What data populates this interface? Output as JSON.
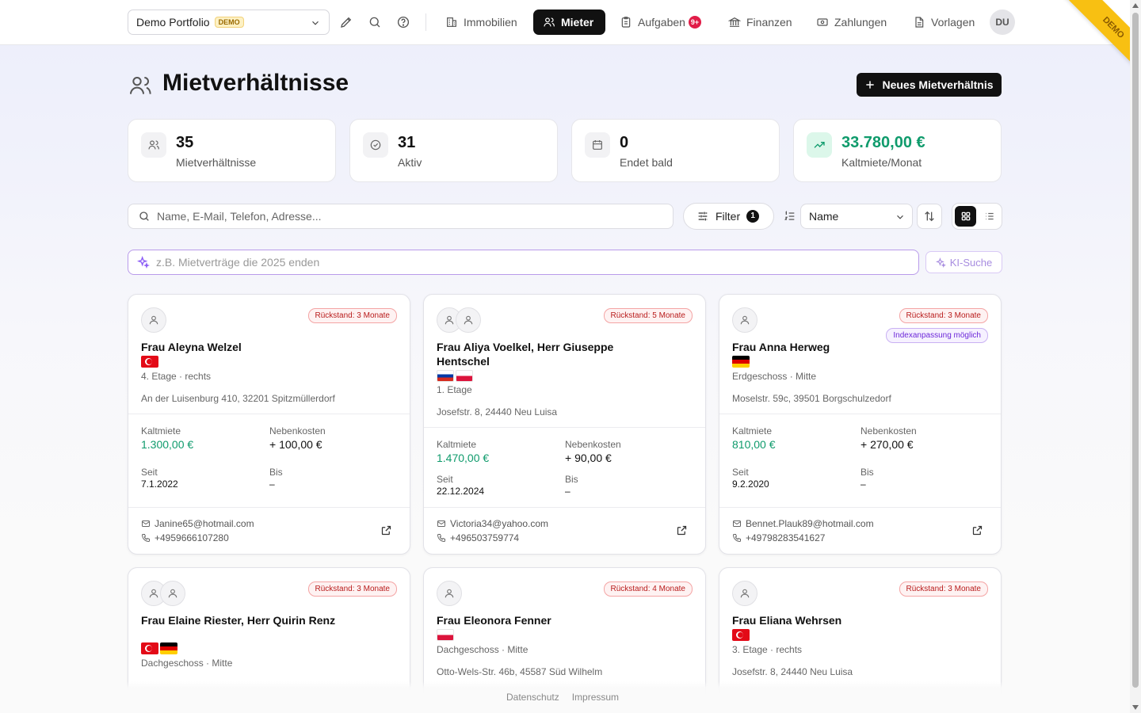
{
  "header": {
    "portfolio_name": "Demo Portfolio",
    "portfolio_badge": "DEMO",
    "nav": [
      {
        "label": "Immobilien",
        "icon": "building-icon"
      },
      {
        "label": "Mieter",
        "icon": "users-icon",
        "active": true
      },
      {
        "label": "Aufgaben",
        "icon": "clipboard-icon",
        "badge": "9+"
      },
      {
        "label": "Finanzen",
        "icon": "bank-icon"
      },
      {
        "label": "Zahlungen",
        "icon": "banknote-icon"
      },
      {
        "label": "Vorlagen",
        "icon": "file-icon"
      }
    ],
    "user_initials": "DU",
    "ribbon": "DEMO"
  },
  "page": {
    "title": "Mietverhältnisse",
    "new_button": "Neues Mietverhältnis"
  },
  "stats": [
    {
      "value": "35",
      "label": "Mietverhältnisse",
      "icon": "users-icon"
    },
    {
      "value": "31",
      "label": "Aktiv",
      "icon": "check-circle-icon"
    },
    {
      "value": "0",
      "label": "Endet bald",
      "icon": "calendar-icon"
    },
    {
      "value": "33.780,00 €",
      "label": "Kaltmiete/Monat",
      "icon": "trending-up-icon",
      "accent": "#0f9b6c"
    }
  ],
  "toolbar": {
    "search_placeholder": "Name, E-Mail, Telefon, Adresse...",
    "filter_label": "Filter",
    "filter_count": "1",
    "sort_value": "Name",
    "ai_placeholder": "z.B. Mietverträge die 2025 enden",
    "ai_button": "KI-Suche"
  },
  "labels": {
    "kaltmiete": "Kaltmiete",
    "nebenkosten": "Nebenkosten",
    "seit": "Seit",
    "bis": "Bis"
  },
  "cards": [
    {
      "name": "Frau Aleyna Welzel",
      "badges": [
        "Rückstand: 3 Monate"
      ],
      "flags": [
        "tr"
      ],
      "floor": "4. Etage · rechts",
      "address": "An der Luisenburg 410, 32201 Spitzmüllerdorf",
      "kaltmiete": "1.300,00 €",
      "nebenkosten": "+ 100,00 €",
      "seit": "7.1.2022",
      "bis": "–",
      "email": "Janine65@hotmail.com",
      "phone": "+4959666107280"
    },
    {
      "name": "Frau Aliya Voelkel, Herr Giuseppe Hentschel",
      "badges": [
        "Rückstand: 5 Monate"
      ],
      "flags": [
        "ru",
        "pl"
      ],
      "floor": "1. Etage",
      "address": "Josefstr. 8, 24440 Neu Luisa",
      "kaltmiete": "1.470,00 €",
      "nebenkosten": "+ 90,00 €",
      "seit": "22.12.2024",
      "bis": "–",
      "email": "Victoria34@yahoo.com",
      "phone": "+496503759774"
    },
    {
      "name": "Frau Anna Herweg",
      "badges": [
        "Rückstand: 3 Monate",
        "Indexanpassung möglich"
      ],
      "flags": [
        "de"
      ],
      "floor": "Erdgeschoss · Mitte",
      "address": "Moselstr. 59c, 39501 Borgschulzedorf",
      "kaltmiete": "810,00 €",
      "nebenkosten": "+ 270,00 €",
      "seit": "9.2.2020",
      "bis": "–",
      "email": "Bennet.Plauk89@hotmail.com",
      "phone": "+49798283541627"
    },
    {
      "name": "Frau Elaine Riester, Herr Quirin Renz",
      "badges": [
        "Rückstand: 3 Monate"
      ],
      "flags": [
        "tr",
        "de"
      ],
      "floor": "Dachgeschoss · Mitte"
    },
    {
      "name": "Frau Eleonora Fenner",
      "badges": [
        "Rückstand: 4 Monate"
      ],
      "flags": [
        "pl"
      ],
      "floor": "Dachgeschoss · Mitte",
      "address": "Otto-Wels-Str. 46b, 45587 Süd Wilhelm"
    },
    {
      "name": "Frau Eliana Wehrsen",
      "badges": [
        "Rückstand: 3 Monate"
      ],
      "flags": [
        "tr"
      ],
      "floor": "3. Etage · rechts",
      "address": "Josefstr. 8, 24440 Neu Luisa"
    }
  ],
  "footer": {
    "privacy": "Datenschutz",
    "imprint": "Impressum"
  }
}
